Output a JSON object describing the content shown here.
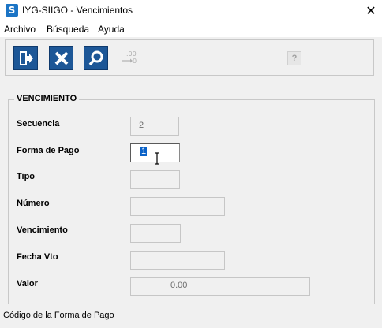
{
  "window": {
    "app_icon_letter": "S",
    "title": "IYG-SIIGO - Vencimientos",
    "close_glyph": "✕"
  },
  "menu": {
    "items": [
      {
        "label": "Archivo"
      },
      {
        "label": "Búsqueda"
      },
      {
        "label": "Ayuda"
      }
    ]
  },
  "toolbar": {
    "buttons": [
      {
        "icon": "exit-icon"
      },
      {
        "icon": "delete-x-icon"
      },
      {
        "icon": "search-magnifier-icon"
      },
      {
        "icon": "decimals-icon",
        "label": ".00",
        "disabled": true
      }
    ],
    "help_label": "?"
  },
  "group": {
    "title": "VENCIMIENTO",
    "fields": [
      {
        "label": "Secuencia",
        "value": "2"
      },
      {
        "label": "Forma de Pago",
        "value": "1"
      },
      {
        "label": "Tipo",
        "value": ""
      },
      {
        "label": "Número",
        "value": ""
      },
      {
        "label": "Vencimiento",
        "value": ""
      },
      {
        "label": "Fecha Vto",
        "value": ""
      },
      {
        "label": "Valor",
        "value": "0.00"
      }
    ]
  },
  "status": {
    "text": "Código de la Forma de Pago"
  },
  "colors": {
    "toolbar_button": "#1d5797",
    "selection": "#0a62c8",
    "app_icon": "#1b74c5"
  }
}
